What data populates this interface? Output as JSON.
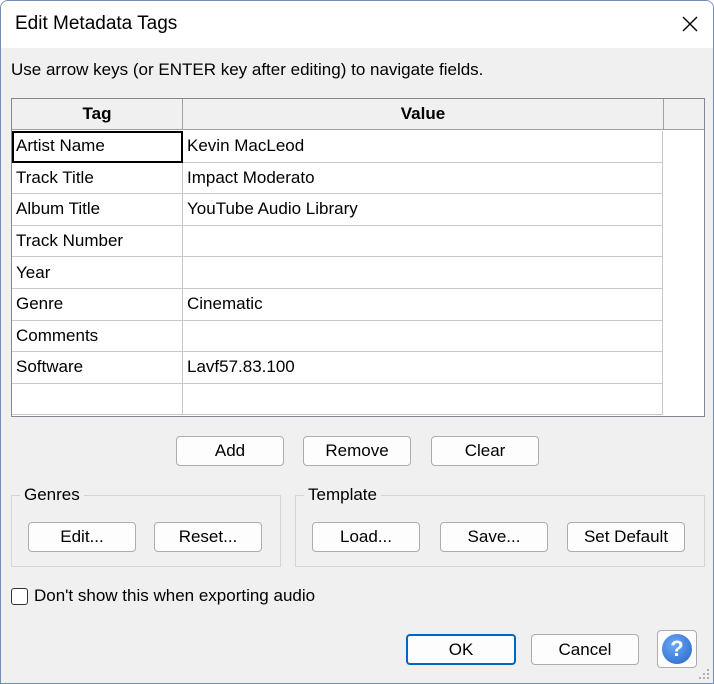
{
  "window": {
    "title": "Edit Metadata Tags"
  },
  "instruction": "Use arrow keys (or ENTER key after editing) to navigate fields.",
  "table": {
    "headers": {
      "tag": "Tag",
      "value": "Value"
    },
    "rows": [
      {
        "tag": "Artist Name",
        "value": "Kevin MacLeod"
      },
      {
        "tag": "Track Title",
        "value": "Impact Moderato"
      },
      {
        "tag": "Album Title",
        "value": "YouTube Audio Library"
      },
      {
        "tag": "Track Number",
        "value": ""
      },
      {
        "tag": "Year",
        "value": ""
      },
      {
        "tag": "Genre",
        "value": "Cinematic"
      },
      {
        "tag": "Comments",
        "value": ""
      },
      {
        "tag": "Software",
        "value": "Lavf57.83.100"
      },
      {
        "tag": "",
        "value": ""
      }
    ]
  },
  "row_buttons": {
    "add": "Add",
    "remove": "Remove",
    "clear": "Clear"
  },
  "genres": {
    "label": "Genres",
    "edit": "Edit...",
    "reset": "Reset..."
  },
  "template": {
    "label": "Template",
    "load": "Load...",
    "save": "Save...",
    "set_default": "Set Default"
  },
  "checkbox": {
    "label": "Don't show this when exporting audio",
    "checked": false
  },
  "footer": {
    "ok": "OK",
    "cancel": "Cancel",
    "help": "?"
  },
  "colors": {
    "accent": "#0067c0",
    "help_blue": "#2563c8"
  }
}
